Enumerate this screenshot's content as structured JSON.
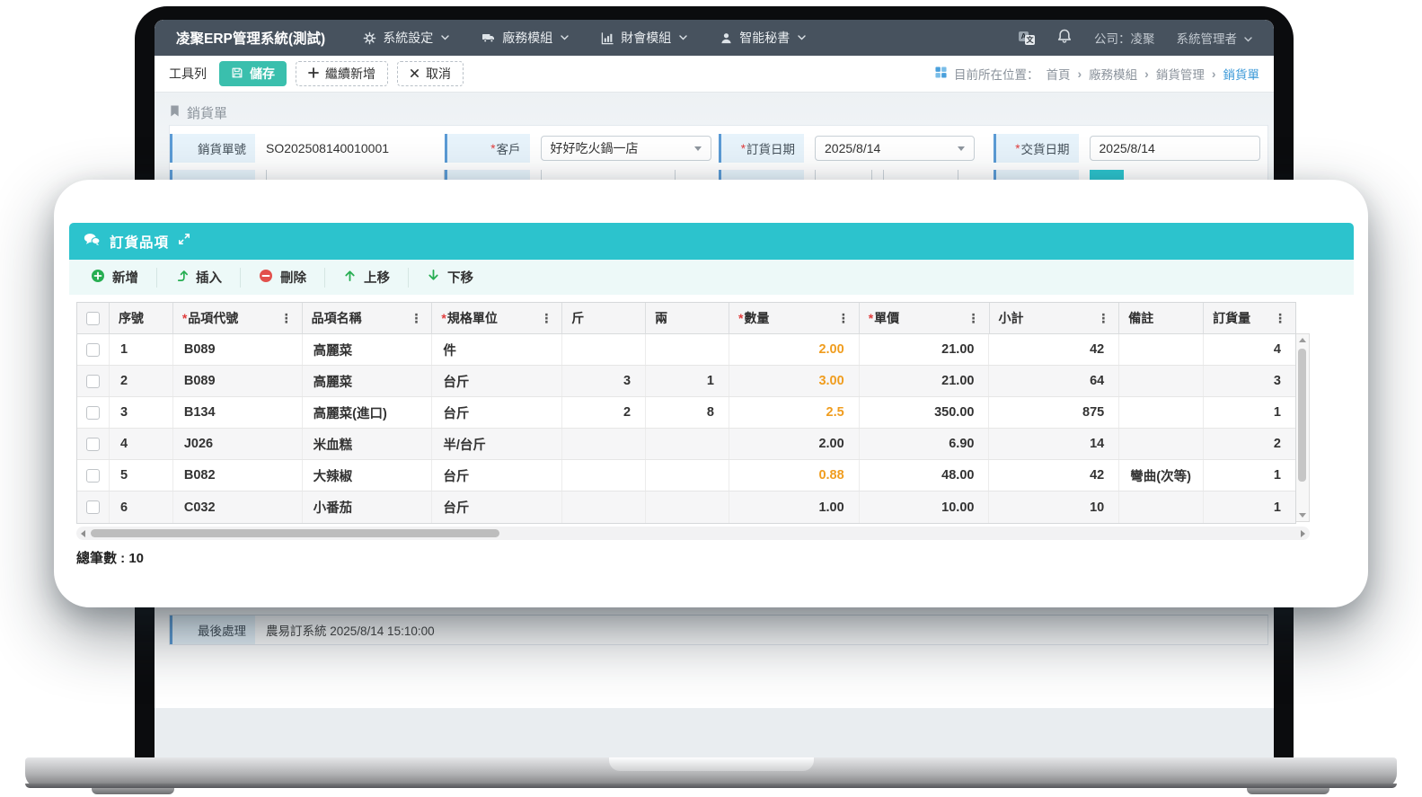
{
  "colors": {
    "navbar_bg": "#47525e",
    "modal_teal": "#2cc3cd",
    "save_button_teal": "#3abfad",
    "breadcrumb_active_blue": "#3d9ad8",
    "field_accent_blue": "#5b9bd5",
    "field_label_bg": "#e7f3fb",
    "action_green": "#27ae52",
    "action_red": "#e2504c",
    "qty_highlight_orange": "#f09d1f"
  },
  "navbar": {
    "brand": "凌聚ERP管理系統(測試)",
    "menus": [
      {
        "label": "系統設定",
        "icon": "gear-icon"
      },
      {
        "label": "廠務模組",
        "icon": "truck-icon"
      },
      {
        "label": "財會模組",
        "icon": "chart-icon"
      },
      {
        "label": "智能秘書",
        "icon": "assistant-icon"
      }
    ],
    "company": "公司：凌聚",
    "user": "系統管理者"
  },
  "toolbar": {
    "label": "工具列",
    "save": "儲存",
    "continue_add": "繼續新增",
    "cancel": "取消"
  },
  "breadcrumb": {
    "prefix": "目前所在位置：",
    "items": [
      "首頁",
      "廠務模組",
      "銷貨管理",
      "銷貨單"
    ]
  },
  "page": {
    "title": "銷貨單"
  },
  "form": {
    "order_no": {
      "label": "銷貨單號",
      "required": false,
      "value": "SO202508140010001"
    },
    "customer": {
      "label": "客戶",
      "required": true,
      "value": "好好吃火鍋一店"
    },
    "order_date": {
      "label": "訂貨日期",
      "required": true,
      "value": "2025/8/14"
    },
    "delivery_date": {
      "label": "交貨日期",
      "required": true,
      "value": "2025/8/14"
    },
    "last_process": {
      "label": "最後處理",
      "value": "農易訂系統 2025/8/14 15:10:00"
    }
  },
  "modal": {
    "title": "訂貨品項",
    "actions": [
      {
        "label": "新增",
        "icon": "plus-circle-icon"
      },
      {
        "label": "插入",
        "icon": "insert-icon"
      },
      {
        "label": "刪除",
        "icon": "minus-circle-icon"
      },
      {
        "label": "上移",
        "icon": "arrow-up-icon"
      },
      {
        "label": "下移",
        "icon": "arrow-down-icon"
      }
    ],
    "table": {
      "columns": [
        {
          "key": "seq",
          "label": "序號",
          "required": false,
          "menu": false
        },
        {
          "key": "code",
          "label": "品項代號",
          "required": true,
          "menu": true
        },
        {
          "key": "name",
          "label": "品項名稱",
          "required": false,
          "menu": true
        },
        {
          "key": "unit",
          "label": "規格單位",
          "required": true,
          "menu": true
        },
        {
          "key": "jin",
          "label": "斤",
          "required": false,
          "menu": false
        },
        {
          "key": "liang",
          "label": "兩",
          "required": false,
          "menu": false
        },
        {
          "key": "qty",
          "label": "數量",
          "required": true,
          "menu": true
        },
        {
          "key": "price",
          "label": "單價",
          "required": true,
          "menu": true
        },
        {
          "key": "subtotal",
          "label": "小計",
          "required": false,
          "menu": true
        },
        {
          "key": "note",
          "label": "備註",
          "required": false,
          "menu": false
        },
        {
          "key": "order_qty",
          "label": "訂貨量",
          "required": false,
          "menu": true
        }
      ],
      "rows": [
        {
          "seq": "1",
          "code": "B089",
          "name": "高麗菜",
          "unit": "件",
          "jin": "",
          "liang": "",
          "qty": "2.00",
          "qty_highlight": true,
          "price": "21.00",
          "subtotal": "42",
          "note": "",
          "order_qty": "4"
        },
        {
          "seq": "2",
          "code": "B089",
          "name": "高麗菜",
          "unit": "台斤",
          "jin": "3",
          "liang": "1",
          "qty": "3.00",
          "qty_highlight": true,
          "price": "21.00",
          "subtotal": "64",
          "note": "",
          "order_qty": "3"
        },
        {
          "seq": "3",
          "code": "B134",
          "name": "高麗菜(進口)",
          "unit": "台斤",
          "jin": "2",
          "liang": "8",
          "qty": "2.5",
          "qty_highlight": true,
          "price": "350.00",
          "subtotal": "875",
          "note": "",
          "order_qty": "1"
        },
        {
          "seq": "4",
          "code": "J026",
          "name": "米血糕",
          "unit": "半/台斤",
          "jin": "",
          "liang": "",
          "qty": "2.00",
          "qty_highlight": false,
          "price": "6.90",
          "subtotal": "14",
          "note": "",
          "order_qty": "2"
        },
        {
          "seq": "5",
          "code": "B082",
          "name": "大辣椒",
          "unit": "台斤",
          "jin": "",
          "liang": "",
          "qty": "0.88",
          "qty_highlight": true,
          "price": "48.00",
          "subtotal": "42",
          "note": "彎曲(次等)",
          "order_qty": "1"
        },
        {
          "seq": "6",
          "code": "C032",
          "name": "小番茄",
          "unit": "台斤",
          "jin": "",
          "liang": "",
          "qty": "1.00",
          "qty_highlight": false,
          "price": "10.00",
          "subtotal": "10",
          "note": "",
          "order_qty": "1"
        }
      ]
    },
    "total": "總筆數 : 10"
  }
}
